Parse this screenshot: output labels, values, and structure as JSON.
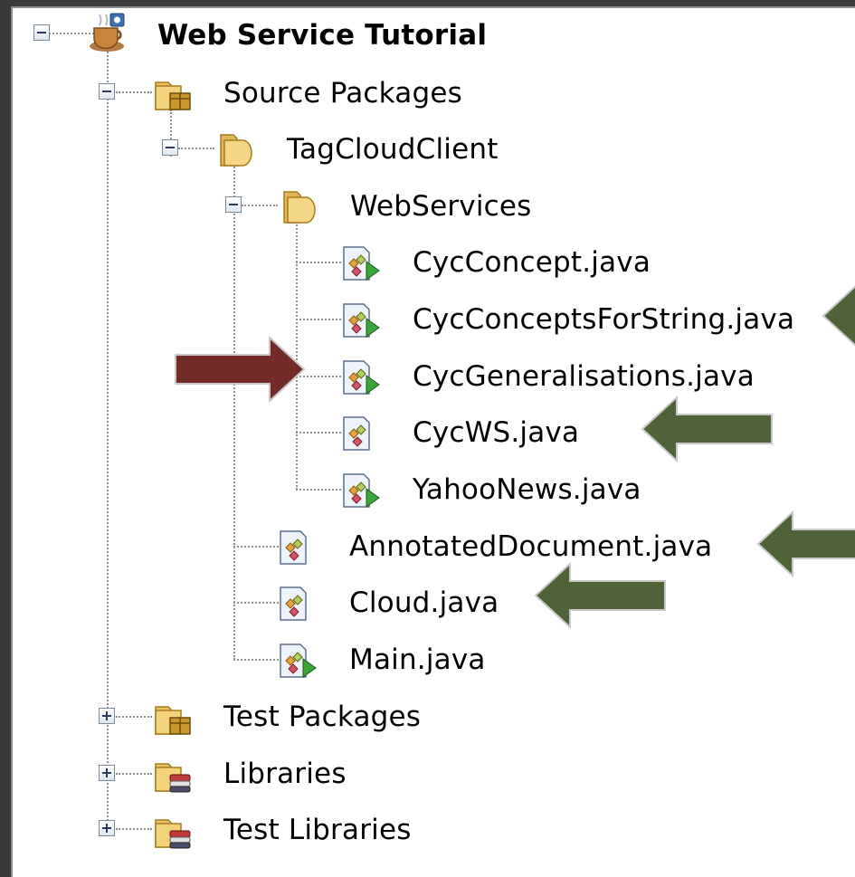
{
  "project": {
    "name": "Web Service Tutorial",
    "icon": "coffee-cup-project-icon"
  },
  "tree": [
    {
      "label": "Source Packages",
      "icon": "source-package-folder-icon",
      "expanded": true
    },
    {
      "label": "TagCloudClient",
      "icon": "package-folder-icon",
      "expanded": true
    },
    {
      "label": "WebServices",
      "icon": "package-folder-icon",
      "expanded": true
    },
    {
      "label": "CycConcept.java",
      "icon": "java-main-class-icon"
    },
    {
      "label": "CycConceptsForString.java",
      "icon": "java-main-class-icon"
    },
    {
      "label": "CycGeneralisations.java",
      "icon": "java-main-class-icon"
    },
    {
      "label": "CycWS.java",
      "icon": "java-class-icon"
    },
    {
      "label": "YahooNews.java",
      "icon": "java-main-class-icon"
    },
    {
      "label": "AnnotatedDocument.java",
      "icon": "java-class-icon"
    },
    {
      "label": "Cloud.java",
      "icon": "java-class-icon"
    },
    {
      "label": "Main.java",
      "icon": "java-main-class-icon"
    },
    {
      "label": "Test Packages",
      "icon": "source-package-folder-icon",
      "expanded": false
    },
    {
      "label": "Libraries",
      "icon": "library-folder-icon",
      "expanded": false
    },
    {
      "label": "Test Libraries",
      "icon": "library-folder-icon",
      "expanded": false
    }
  ],
  "annotations": {
    "highlight_color": "#722b27",
    "pointer_color": "#4f6238"
  }
}
